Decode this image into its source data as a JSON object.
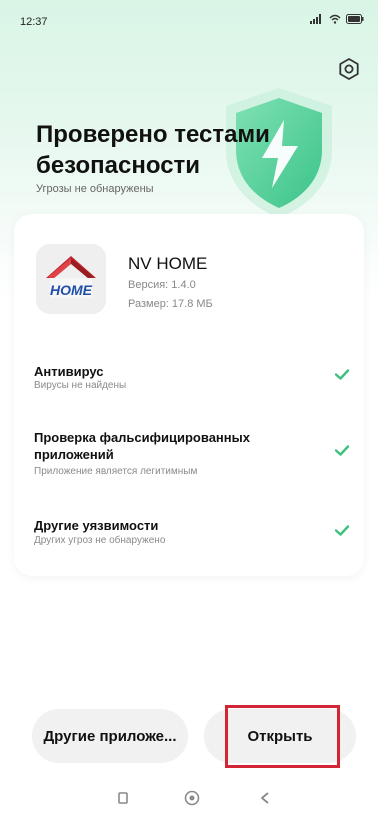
{
  "status_bar": {
    "time": "12:37",
    "icons": [
      "signal-icon",
      "wifi-icon",
      "battery-icon"
    ]
  },
  "header": {
    "settings_icon": "settings-icon",
    "title": "Проверено тестами безопасности",
    "subtitle": "Угрозы не обнаружены",
    "badge_icon": "shield-lightning-icon"
  },
  "app": {
    "name": "NV HOME",
    "icon_text": "HOME",
    "version": "Версия: 1.4.0",
    "size": "Размер: 17.8 МБ"
  },
  "checks": [
    {
      "title": "Антивирус",
      "subtitle": "Вирусы не найдены",
      "status": "check-icon"
    },
    {
      "title": "Проверка фальсифицированных приложений",
      "subtitle": "Приложение является легитимным",
      "status": "check-icon"
    },
    {
      "title": "Другие уязвимости",
      "subtitle": "Других угроз не обнаружено",
      "status": "check-icon"
    }
  ],
  "actions": {
    "other_apps_label": "Другие приложе...",
    "open_label": "Открыть"
  },
  "nav_bar": {
    "items": [
      "recents-icon",
      "home-icon",
      "back-icon"
    ]
  },
  "colors": {
    "accent_green": "#3fbf7f",
    "highlight_red": "#d32635",
    "background_mint": "#d9f5e6"
  }
}
